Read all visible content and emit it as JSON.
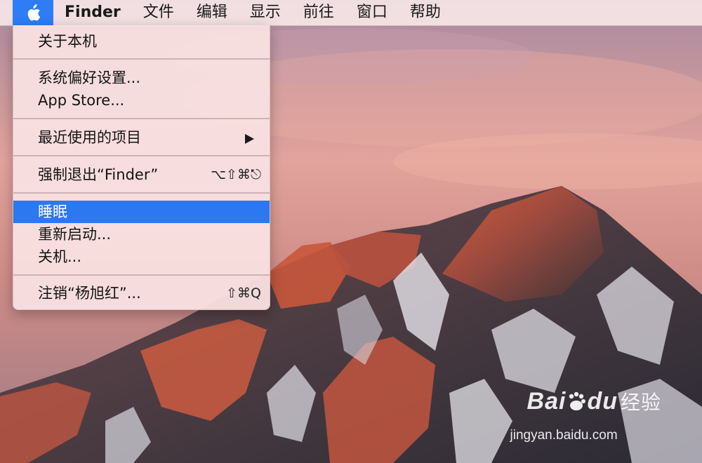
{
  "menubar": {
    "items": [
      "Finder",
      "文件",
      "编辑",
      "显示",
      "前往",
      "窗口",
      "帮助"
    ]
  },
  "apple_menu": {
    "about": "关于本机",
    "system_prefs": "系统偏好设置...",
    "app_store": "App Store...",
    "recent_items": "最近使用的项目",
    "force_quit": "强制退出“Finder”",
    "force_quit_shortcut": "⌥⇧⌘⎋",
    "sleep": "睡眠",
    "restart": "重新启动...",
    "shutdown": "关机...",
    "logout": "注销“杨旭红”...",
    "logout_shortcut": "⇧⌘Q",
    "selected": "睡眠"
  },
  "watermark": {
    "logo_latin": "Bai",
    "logo_mid": "du",
    "logo_cn": "经验",
    "url": "jingyan.baidu.com"
  },
  "colors": {
    "highlight": "#2c78f0",
    "apple_button": "#2e7cf6"
  }
}
